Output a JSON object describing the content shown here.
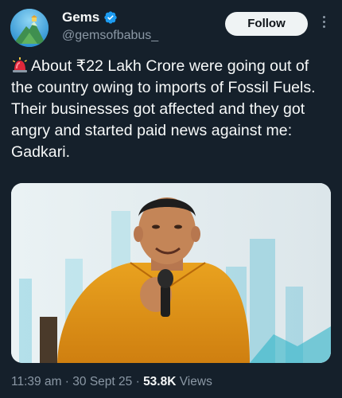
{
  "author": {
    "display_name": "Gems",
    "handle": "@gemsofbabus_",
    "verified": true,
    "avatar_icon": "mountain-avatar-icon"
  },
  "follow_label": "Follow",
  "tweet": {
    "emoji_icon": "police-siren-icon",
    "text": "About ₹22 Lakh Crore were going out of the country owing to imports of Fossil Fuels. Their businesses got affected and they got angry and started paid news against me: Gadkari."
  },
  "meta": {
    "time": "11:39 am",
    "separator": "·",
    "date": "30 Sept 25",
    "views_count": "53.8K",
    "views_label": "Views"
  },
  "colors": {
    "background": "#15202b",
    "text": "#f7f9f9",
    "muted": "#8b98a5",
    "verified_blue": "#1d9bf0",
    "follow_bg": "#eff3f4"
  }
}
